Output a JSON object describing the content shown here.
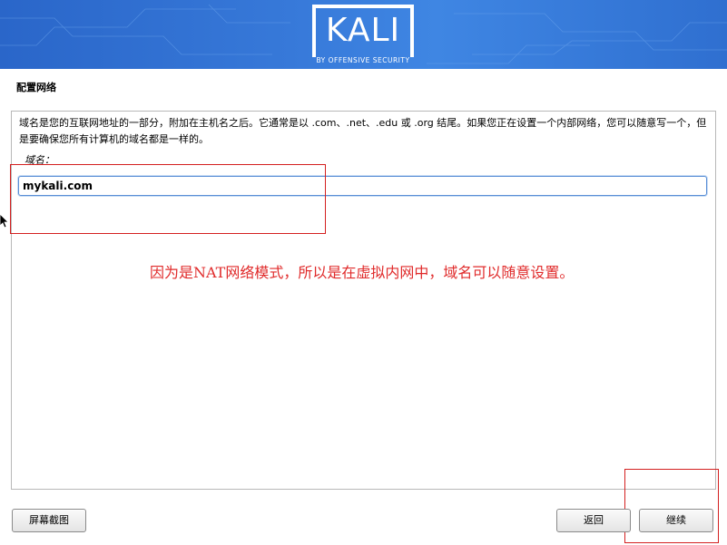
{
  "header": {
    "logo_text": "KALI",
    "tagline": "BY OFFENSIVE SECURITY",
    "colors": {
      "banner": "#3779d9",
      "logo": "#ffffff"
    }
  },
  "page": {
    "title": "配置网络",
    "description": "域名是您的互联网地址的一部分，附加在主机名之后。它通常是以 .com、.net、.edu 或 .org 结尾。如果您正在设置一个内部网络，您可以随意写一个，但是要确保您所有计算机的域名都是一样的。",
    "field_label": "域名：",
    "domain_value": "mykali.com"
  },
  "annotation": {
    "text": "因为是NAT网络模式，所以是在虚拟内网中，域名可以随意设置。",
    "color": "#e02b2b"
  },
  "buttons": {
    "screenshot": "屏幕截图",
    "back": "返回",
    "continue": "继续"
  }
}
